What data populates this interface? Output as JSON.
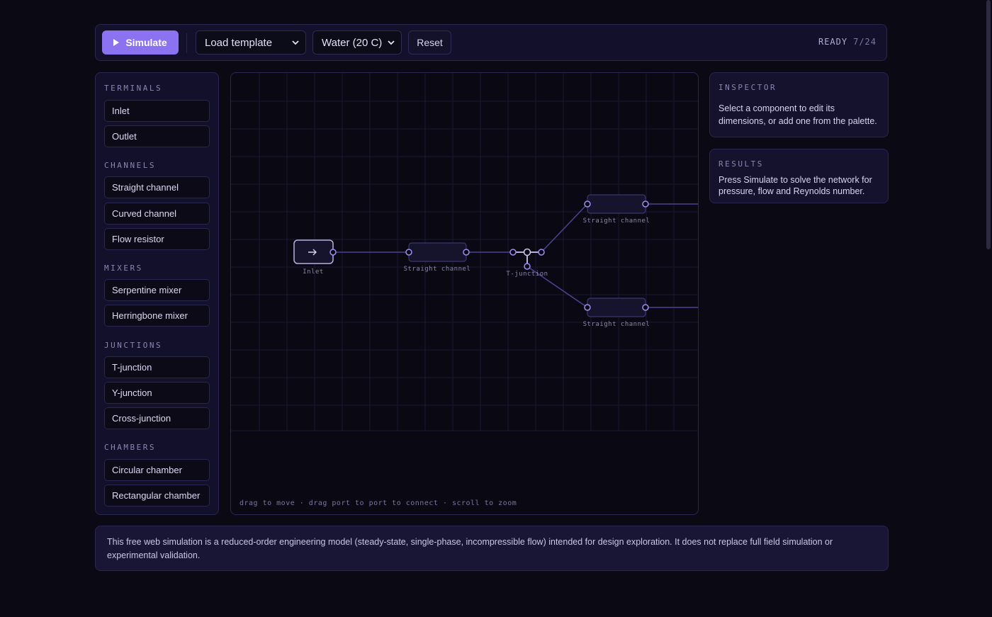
{
  "toolbar": {
    "simulate_label": "Simulate",
    "template_select": "Load template",
    "fluid_select": "Water (20 C)",
    "reset_label": "Reset",
    "status": "READY",
    "count": "7/24"
  },
  "palette": {
    "terminals": {
      "heading": "TERMINALS",
      "items": [
        "Inlet",
        "Outlet"
      ]
    },
    "channels": {
      "heading": "CHANNELS",
      "items": [
        "Straight channel",
        "Curved channel",
        "Flow resistor"
      ]
    },
    "mixers": {
      "heading": "MIXERS",
      "items": [
        "Serpentine mixer",
        "Herringbone mixer"
      ]
    },
    "junctions": {
      "heading": "JUNCTIONS",
      "items": [
        "T-junction",
        "Y-junction",
        "Cross-junction"
      ]
    },
    "chambers": {
      "heading": "CHAMBERS",
      "items": [
        "Circular chamber",
        "Rectangular chamber"
      ]
    }
  },
  "canvas": {
    "nodes": {
      "inlet": "Inlet",
      "channel1": "Straight channel",
      "tjunction": "T-junction",
      "channel2": "Straight channel",
      "channel3": "Straight channel"
    },
    "hint": "drag to move · drag port to port to connect · scroll to zoom"
  },
  "inspector": {
    "title": "INSPECTOR",
    "body": "Select a component to edit its dimensions, or add one from the palette."
  },
  "results": {
    "title": "RESULTS",
    "body": "Press Simulate to solve the network for pressure, flow and Reynolds number."
  },
  "footer": {
    "text": "This free web simulation is a reduced-order engineering model (steady-state, single-phase, incompressible flow) intended for design exploration. It does not replace full field simulation or experimental validation."
  },
  "colors": {
    "accent": "#8b72f0",
    "background": "#0b0a14",
    "panel": "#12102a"
  }
}
